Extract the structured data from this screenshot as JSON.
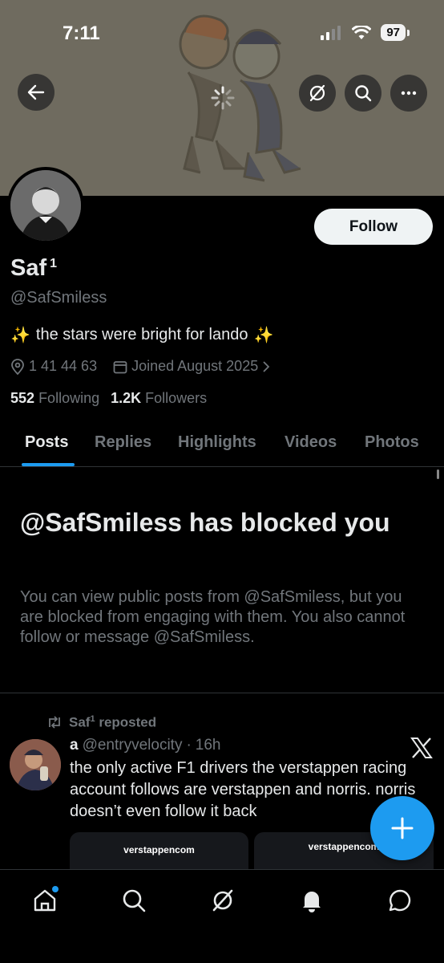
{
  "status_bar": {
    "time": "7:11",
    "battery": "97"
  },
  "profile": {
    "display_name": "Saf",
    "name_badge": "1",
    "handle": "@SafSmiless",
    "bio": "the stars were bright for lando",
    "bio_emoji": "✨",
    "location": "1 41 44 63",
    "joined": "Joined August 2025",
    "following_count": "552",
    "following_label": "Following",
    "followers_count": "1.2K",
    "followers_label": "Followers",
    "follow_button": "Follow"
  },
  "tabs": [
    "Posts",
    "Replies",
    "Highlights",
    "Videos",
    "Photos"
  ],
  "active_tab": "Posts",
  "blocked": {
    "title": "@SafSmiless has blocked you",
    "message": "You can view public posts from @SafSmiless, but you are blocked from engaging with them. You also cannot follow or message @SafSmiless."
  },
  "post": {
    "repost_by": "Saf",
    "repost_badge": "1",
    "repost_label": "reposted",
    "author_name": "a",
    "author_handle": "@entryvelocity",
    "separator": "·",
    "time": "16h",
    "text": "the only active F1 drivers the verstappen racing account follows are verstappen and norris. norris doesn’t even follow it back",
    "media_left_label": "verstappencom",
    "media_right_label": "verstappencom"
  },
  "icons": {
    "back": "arrow-left-icon",
    "grok": "grok-icon",
    "search": "search-icon",
    "more": "more-icon",
    "location": "location-pin-icon",
    "calendar": "calendar-icon",
    "repost": "repost-icon",
    "compose": "plus-icon",
    "nav": [
      "home-icon",
      "search-icon",
      "grok-icon",
      "bell-icon",
      "messages-icon"
    ]
  },
  "colors": {
    "accent": "#1d9bf0",
    "background": "#000000",
    "muted": "#71767b",
    "text": "#e7e9ea"
  }
}
